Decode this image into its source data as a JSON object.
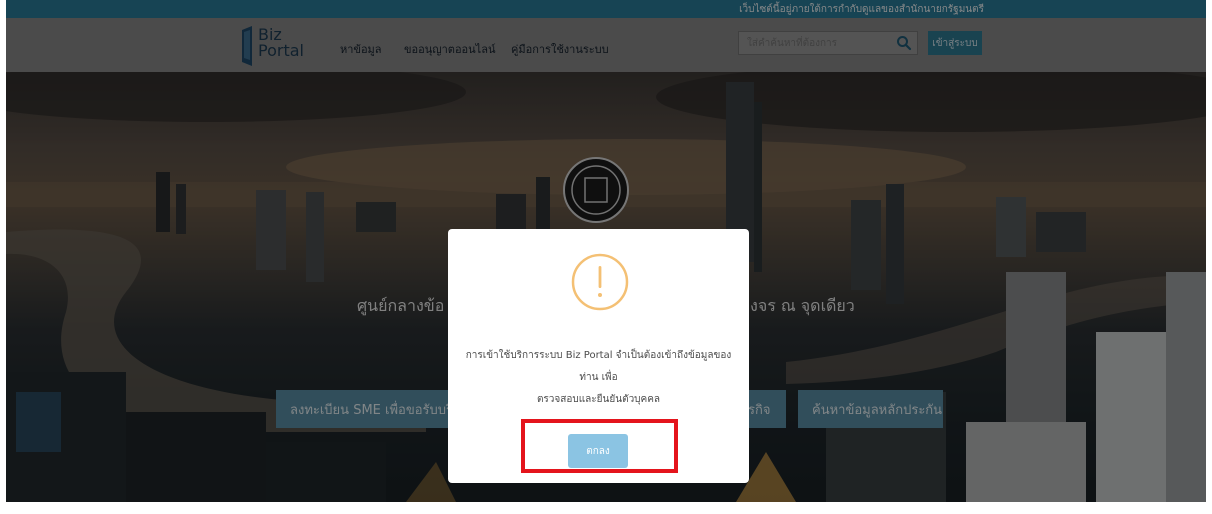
{
  "topbar": {
    "notice": "เว็บไซต์นี้อยู่ภายใต้การกำกับดูแลของสำนักนายกรัฐมนตรี"
  },
  "header": {
    "logo_text_1": "Biz",
    "logo_text_2": "Portal",
    "nav": [
      {
        "label": "หาข้อมูล"
      },
      {
        "label": "ขออนุญาตออนไลน์"
      },
      {
        "label": "คู่มือการใช้งานระบบ"
      }
    ],
    "search": {
      "placeholder": "ใส่คำค้นหาที่ต้องการ"
    },
    "login_label": "เข้าสู่ระบบ"
  },
  "hero": {
    "title_left": "ศูนย์กลางข้อ",
    "title_right": "งจร ณ จุดเดียว",
    "buttons": [
      {
        "label": "ลงทะเบียน SME เพื่อขอรับบริก"
      },
      {
        "label": "รกิจ"
      },
      {
        "label": "ค้นหาข้อมูลหลักประกัน"
      }
    ]
  },
  "modal": {
    "icon": "warning-circle-icon",
    "message_line1": "การเข้าใช้บริการระบบ Biz Portal จำเป็นต้องเข้าถึงข้อมูลของท่าน เพื่อ",
    "message_line2": "ตรวจสอบและยืนยันตัวบุคคล",
    "ok_label": "ตกลง"
  },
  "colors": {
    "topbar": "#2a7d9a",
    "accent": "#2f7b93",
    "ok_button": "#8bc4e3",
    "warning": "#f4c074",
    "highlight": "#e4141c"
  }
}
